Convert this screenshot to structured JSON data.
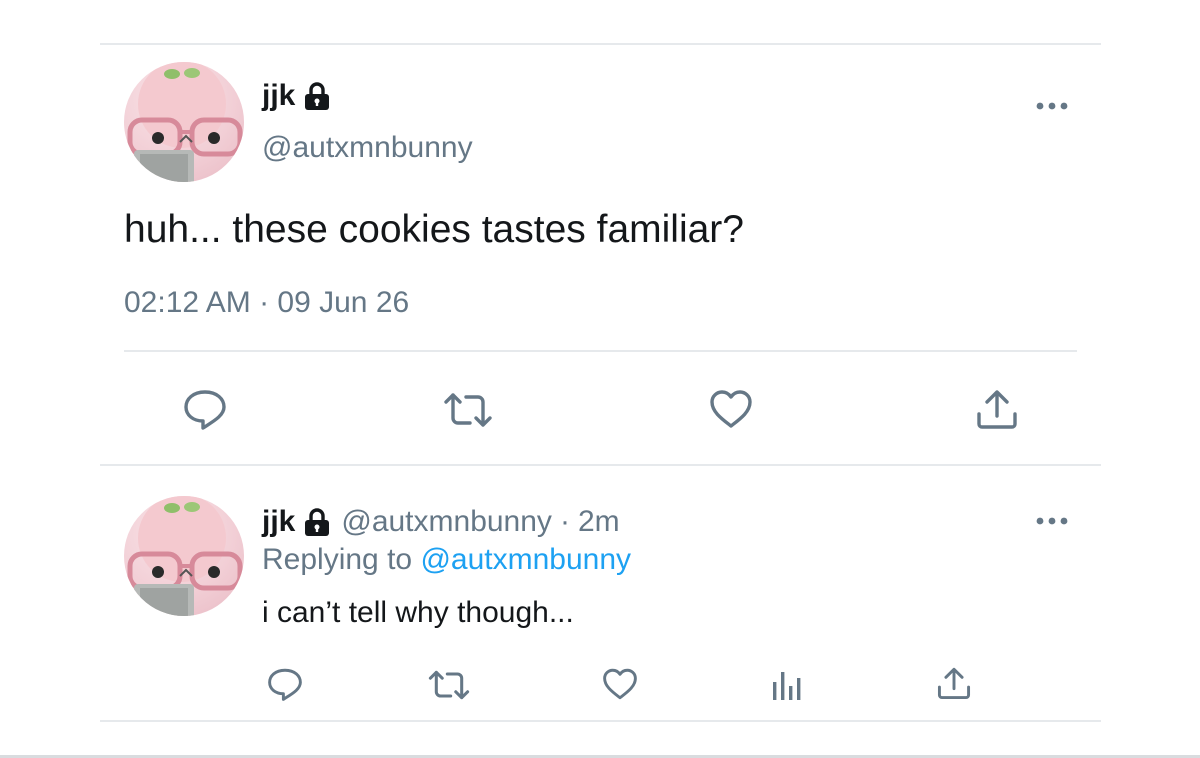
{
  "tweet": {
    "display_name": "jjk",
    "handle": "@autxmnbunny",
    "text": "huh... these cookies tastes familiar?",
    "timestamp": "02:12 AM · 09 Jun 26",
    "actions": [
      "reply-icon",
      "retweet-icon",
      "like-icon",
      "share-icon"
    ]
  },
  "reply": {
    "display_name": "jjk",
    "handle": "@autxmnbunny",
    "separator": "·",
    "time_ago": "2m",
    "replying_prefix": "Replying to",
    "replying_handle": "@autxmnbunny",
    "text": "i can’t tell why though...",
    "actions": [
      "reply-icon",
      "retweet-icon",
      "like-icon",
      "analytics-icon",
      "share-icon"
    ]
  },
  "colors": {
    "text": "#14171a",
    "muted": "#657786",
    "link": "#1da1f2",
    "divider": "#e6e9ec"
  }
}
